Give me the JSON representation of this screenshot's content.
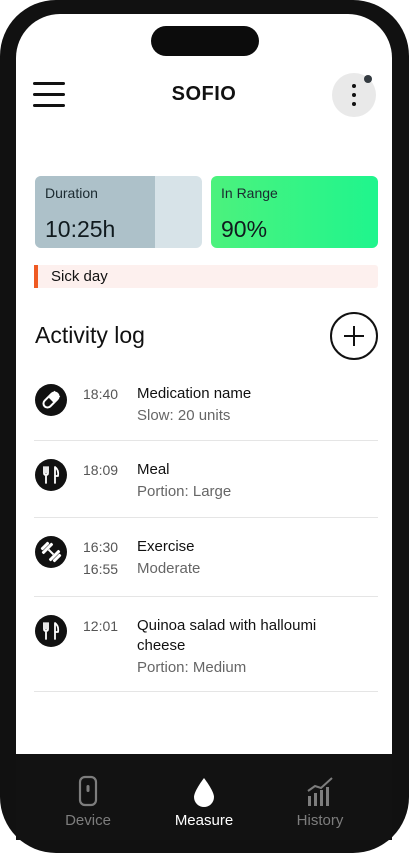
{
  "app": {
    "title": "SOFIO"
  },
  "header": {
    "menu_icon": "hamburger-icon",
    "more_icon": "kebab-icon"
  },
  "stats": {
    "duration": {
      "label": "Duration",
      "value": "10:25h",
      "progress": 0.72
    },
    "in_range": {
      "label": "In Range",
      "value": "90%"
    }
  },
  "banner": {
    "text": "Sick day",
    "accent": "#ef5a23"
  },
  "activity": {
    "title": "Activity log",
    "add_icon": "plus-icon",
    "items": [
      {
        "icon": "pill-icon",
        "start": "18:40",
        "end": "",
        "name": "Medication name",
        "detail": "Slow: 20 units"
      },
      {
        "icon": "fork-knife-icon",
        "start": "18:09",
        "end": "",
        "name": "Meal",
        "detail": "Portion: Large"
      },
      {
        "icon": "dumbbell-icon",
        "start": "16:30",
        "end": "16:55",
        "name": "Exercise",
        "detail": "Moderate"
      },
      {
        "icon": "fork-knife-icon",
        "start": "12:01",
        "end": "",
        "name": "Quinoa salad with halloumi cheese",
        "detail": "Portion: Medium"
      }
    ]
  },
  "nav": {
    "items": [
      {
        "label": "Device",
        "icon": "device-icon",
        "active": false
      },
      {
        "label": "Measure",
        "icon": "drop-icon",
        "active": true
      },
      {
        "label": "History",
        "icon": "chart-icon",
        "active": false
      }
    ]
  },
  "colors": {
    "in_range": "#1ff58d",
    "duration_fill": "#adc1c9",
    "nav_bg": "#121212"
  }
}
